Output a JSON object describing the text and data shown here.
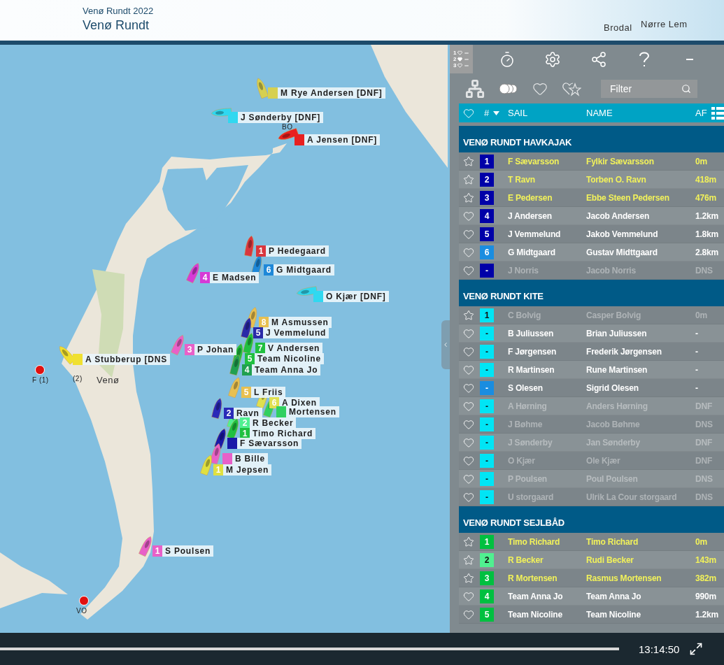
{
  "header": {
    "subtitle": "Venø Rundt 2022",
    "title": "Venø Rundt"
  },
  "map": {
    "places": [
      {
        "kind": "place",
        "label": "Brodal"
      },
      {
        "kind": "place",
        "label": "Nørre Lem"
      },
      {
        "kind": "place",
        "label": "Venø"
      },
      {
        "kind": "caption",
        "label": "BO"
      },
      {
        "kind": "buoy",
        "label": "F (1)"
      },
      {
        "kind": "caption",
        "label": "(2)"
      },
      {
        "kind": "buoy",
        "label": "VO"
      }
    ],
    "markers": [
      {
        "name": "M Rye Andersen [DNF]",
        "color": "#d6d050"
      },
      {
        "name": "J Sønderby [DNF]",
        "color": "#30d8f0"
      },
      {
        "name": "A Jensen [DNF]",
        "color": "#e82020"
      },
      {
        "number": "1",
        "name": "P Hedegaard",
        "color": "#d9363e"
      },
      {
        "number": "6",
        "name": "G Midtgaard",
        "color": "#1e88d8"
      },
      {
        "number": "4",
        "name": "E Madsen",
        "color": "#d63ad6"
      },
      {
        "name": "O Kjær [DNF]",
        "color": "#30d8f0"
      },
      {
        "number": "8",
        "name": "M Asmussen",
        "color": "#e8c050"
      },
      {
        "number": "5",
        "name": "J Vemmelund",
        "color": "#2a2aa8"
      },
      {
        "number": "7",
        "name": "V Andersen",
        "color": "#20c040"
      },
      {
        "number": "5",
        "name": "Team Nicoline",
        "color": "#20c040"
      },
      {
        "number": "4",
        "name": "Team Anna Jo",
        "color": "#20a050"
      },
      {
        "number": "3",
        "name": "P Johan",
        "color": "#e860c8"
      },
      {
        "number": "5",
        "name": "L Friis",
        "color": "#e8c050"
      },
      {
        "number": "6",
        "name": "A Dixen",
        "color": "#e0e050"
      },
      {
        "number": "2",
        "name": "Ravn",
        "color": "#2a2ab8"
      },
      {
        "name": "Mortensen",
        "color": "#30d060"
      },
      {
        "number": "2",
        "name": "R Becker",
        "color": "#50f090"
      },
      {
        "number": "1",
        "name": "Timo Richard",
        "color": "#20c040"
      },
      {
        "name": "F Sævarsson",
        "color": "#1a1aa8"
      },
      {
        "name": "B Bille",
        "color": "#e860c8"
      },
      {
        "number": "1",
        "name": "M Jepsen",
        "color": "#e0e040"
      },
      {
        "name": "A Stubberup [DNS",
        "color": "#f0e030"
      },
      {
        "number": "1",
        "name": "S Poulsen",
        "color": "#e860c8"
      }
    ]
  },
  "toolbar": {
    "tools": [
      {
        "kind": "ranking",
        "selected": true,
        "digits": [
          "1",
          "2",
          "3"
        ]
      },
      {
        "kind": "timer",
        "selected": false
      },
      {
        "kind": "settings",
        "selected": false
      },
      {
        "kind": "share",
        "selected": false
      },
      {
        "kind": "help",
        "selected": false
      },
      {
        "kind": "minimize",
        "selected": false
      }
    ],
    "views": [
      {
        "kind": "groups",
        "selected": false
      },
      {
        "kind": "circles",
        "selected": true
      },
      {
        "kind": "heart",
        "selected": false
      },
      {
        "kind": "heart-star",
        "selected": false
      }
    ],
    "filter": {
      "placeholder": "Filter"
    }
  },
  "table": {
    "columns": [
      {
        "label": "#",
        "sorted": true
      },
      {
        "label": "SAIL",
        "sorted": false
      },
      {
        "label": "NAME",
        "sorted": false
      },
      {
        "label": "AF",
        "sorted": false
      }
    ],
    "sections": [
      {
        "title": "VENØ RUNDT HAVKAJAK",
        "rows": [
          {
            "starred": true,
            "number": "1",
            "color": "#0000a8",
            "sail": "F Sævarsson",
            "name": "Fylkir Sævarsson",
            "af": "0m",
            "leading": true,
            "dimmed": false
          },
          {
            "starred": true,
            "number": "2",
            "color": "#0000a8",
            "sail": "T Ravn",
            "name": "Torben O. Ravn",
            "af": "418m",
            "leading": true,
            "dimmed": false
          },
          {
            "starred": true,
            "number": "3",
            "color": "#0000a8",
            "sail": "E Pedersen",
            "name": "Ebbe Steen Pedersen",
            "af": "476m",
            "leading": true,
            "dimmed": false
          },
          {
            "starred": false,
            "number": "4",
            "color": "#0000a8",
            "sail": "J Andersen",
            "name": "Jacob Andersen",
            "af": "1.2km",
            "leading": false,
            "dimmed": false
          },
          {
            "starred": false,
            "number": "5",
            "color": "#0000a8",
            "sail": "J Vemmelund",
            "name": "Jakob Vemmelund",
            "af": "1.8km",
            "leading": false,
            "dimmed": false
          },
          {
            "starred": false,
            "number": "6",
            "color": "#1a8de0",
            "sail": "G Midtgaard",
            "name": "Gustav Midttgaard",
            "af": "2.8km",
            "leading": false,
            "dimmed": false
          },
          {
            "starred": false,
            "number": "-",
            "color": "#0000a8",
            "sail": "J Norris",
            "name": "Jacob Norris",
            "af": "DNS",
            "leading": false,
            "dimmed": true
          }
        ]
      },
      {
        "title": "VENØ RUNDT KITE",
        "rows": [
          {
            "starred": true,
            "number": "1",
            "color": "#00e5f5",
            "sail": "C Bolvig",
            "name": "Casper Bolvig",
            "af": "0m",
            "leading": false,
            "dimmed": true
          },
          {
            "starred": false,
            "number": "-",
            "color": "#00e5f5",
            "sail": "B Juliussen",
            "name": "Brian Juliussen",
            "af": "-",
            "leading": false,
            "dimmed": false
          },
          {
            "starred": false,
            "number": "-",
            "color": "#00e5f5",
            "sail": "F Jørgensen",
            "name": "Frederik Jørgensen",
            "af": "-",
            "leading": false,
            "dimmed": false
          },
          {
            "starred": false,
            "number": "-",
            "color": "#00e5f5",
            "sail": "R Martinsen",
            "name": "Rune Martinsen",
            "af": "-",
            "leading": false,
            "dimmed": false
          },
          {
            "starred": false,
            "number": "-",
            "color": "#1a8de0",
            "sail": "S Olesen",
            "name": "Sigrid Olesen",
            "af": "-",
            "leading": false,
            "dimmed": false
          },
          {
            "starred": false,
            "number": "-",
            "color": "#00e5f5",
            "sail": "A Hørning",
            "name": "Anders Hørning",
            "af": "DNF",
            "leading": false,
            "dimmed": true
          },
          {
            "starred": false,
            "number": "-",
            "color": "#00e5f5",
            "sail": "J Bøhme",
            "name": "Jacob Bøhme",
            "af": "DNS",
            "leading": false,
            "dimmed": true
          },
          {
            "starred": false,
            "number": "-",
            "color": "#00e5f5",
            "sail": "J Sønderby",
            "name": "Jan Sønderby",
            "af": "DNF",
            "leading": false,
            "dimmed": true
          },
          {
            "starred": false,
            "number": "-",
            "color": "#00e5f5",
            "sail": "O Kjær",
            "name": "Ole Kjær",
            "af": "DNF",
            "leading": false,
            "dimmed": true
          },
          {
            "starred": false,
            "number": "-",
            "color": "#00e5f5",
            "sail": "P Poulsen",
            "name": "Poul Poulsen",
            "af": "DNS",
            "leading": false,
            "dimmed": true
          },
          {
            "starred": false,
            "number": "-",
            "color": "#00e5f5",
            "sail": "U storgaard",
            "name": "Ulrik La Cour storgaard",
            "af": "DNS",
            "leading": false,
            "dimmed": true
          }
        ]
      },
      {
        "title": "VENØ RUNDT SEJLBÅD",
        "rows": [
          {
            "starred": true,
            "number": "1",
            "color": "#00c040",
            "sail": "Timo Richard",
            "name": "Timo Richard",
            "af": "0m",
            "leading": true,
            "dimmed": false
          },
          {
            "starred": true,
            "number": "2",
            "color": "#50f090",
            "sail": "R Becker",
            "name": "Rudi Becker",
            "af": "143m",
            "leading": true,
            "dimmed": false
          },
          {
            "starred": true,
            "number": "3",
            "color": "#00c040",
            "sail": "R Mortensen",
            "name": "Rasmus Mortensen",
            "af": "382m",
            "leading": true,
            "dimmed": false
          },
          {
            "starred": false,
            "number": "4",
            "color": "#00c040",
            "sail": "Team Anna Jo",
            "name": "Team Anna Jo",
            "af": "990m",
            "leading": false,
            "dimmed": false
          },
          {
            "starred": false,
            "number": "5",
            "color": "#00c040",
            "sail": "Team Nicoline",
            "name": "Team Nicoline",
            "af": "1.2km",
            "leading": false,
            "dimmed": false
          }
        ]
      }
    ]
  },
  "playback": {
    "level": 1,
    "time": "13:14:50"
  }
}
